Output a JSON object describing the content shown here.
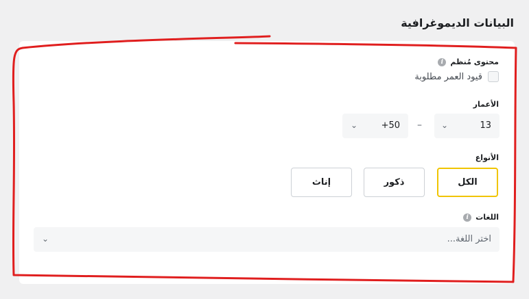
{
  "section": {
    "title": "البيانات الديموغرافية"
  },
  "managed": {
    "label": "محتوى مُنظم"
  },
  "age_restriction": {
    "label": "قيود العمر مطلوبة",
    "checked": false
  },
  "ages": {
    "label": "الأعمار",
    "min_value": "13",
    "max_value": "+50",
    "separator": "–"
  },
  "genders": {
    "label": "الأنواع",
    "options": [
      "الكل",
      "ذكور",
      "إناث"
    ],
    "selected": "الكل"
  },
  "languages": {
    "label": "اللغات",
    "placeholder": "اختر اللغة..."
  },
  "icons": {
    "info": "info-icon",
    "chevron": "chevron-down-icon"
  },
  "colors": {
    "selected_border": "#f0c400",
    "annotation_red": "#e01e1e"
  }
}
